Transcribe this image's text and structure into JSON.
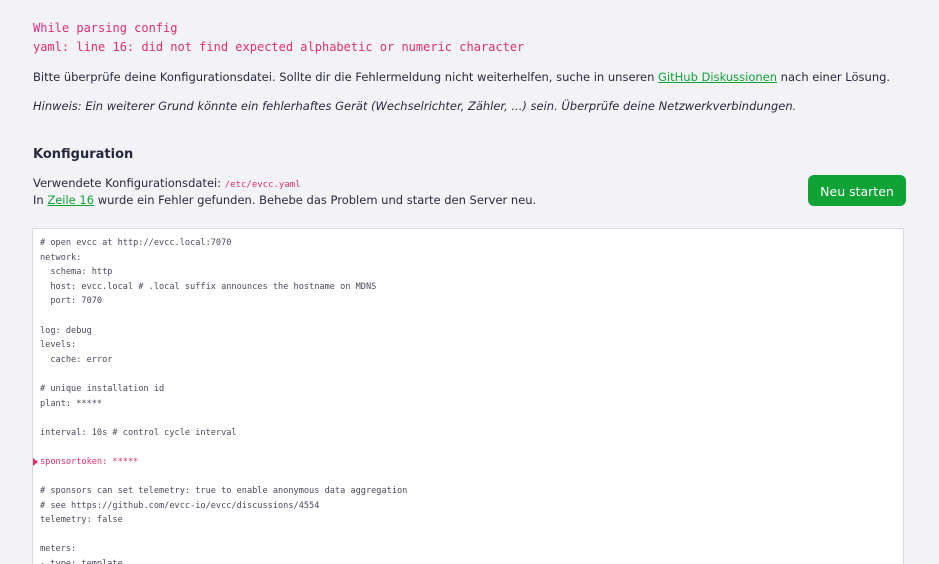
{
  "error": {
    "title": "While parsing config",
    "detail": "yaml: line 16: did not find expected alphabetic or numeric character"
  },
  "help": {
    "before_link": "Bitte überprüfe deine Konfigurationsdatei. Sollte dir die Fehlermeldung nicht weiterhelfen, suche in unseren ",
    "link_label": "GitHub Diskussionen",
    "after_link": " nach einer Lösung."
  },
  "hint": "Hinweis: Ein weiterer Grund könnte ein fehlerhaftes Gerät (Wechselrichter, Zähler, ...) sein. Überprüfe deine Netzwerkverbindungen.",
  "config": {
    "section_title": "Konfiguration",
    "file_label": "Verwendete Konfigurationsdatei: ",
    "file_path": "/etc/evcc.yaml",
    "fix_before": "In ",
    "fix_link": "Zeile 16",
    "fix_after": " wurde ein Fehler gefunden. Behebe das Problem und starte den Server neu.",
    "restart_label": "Neu starten"
  },
  "colors": {
    "accent_green": "#0fa336",
    "error_pink": "#e02e72"
  },
  "code": {
    "error_line_index": 15,
    "lines": [
      "# open evcc at http://evcc.local:7070",
      "network:",
      "  schema: http",
      "  host: evcc.local # .local suffix announces the hostname on MDNS",
      "  port: 7070",
      "",
      "log: debug",
      "levels:",
      "  cache: error",
      "",
      "# unique installation id",
      "plant: *****",
      "",
      "interval: 10s # control cycle interval",
      "",
      "sponsortoken: *****",
      "",
      "# sponsors can set telemetry: true to enable anonymous data aggregation",
      "# see https://github.com/evcc-io/evcc/discussions/4554",
      "telemetry: false",
      "",
      "meters:",
      "- type: template"
    ]
  }
}
